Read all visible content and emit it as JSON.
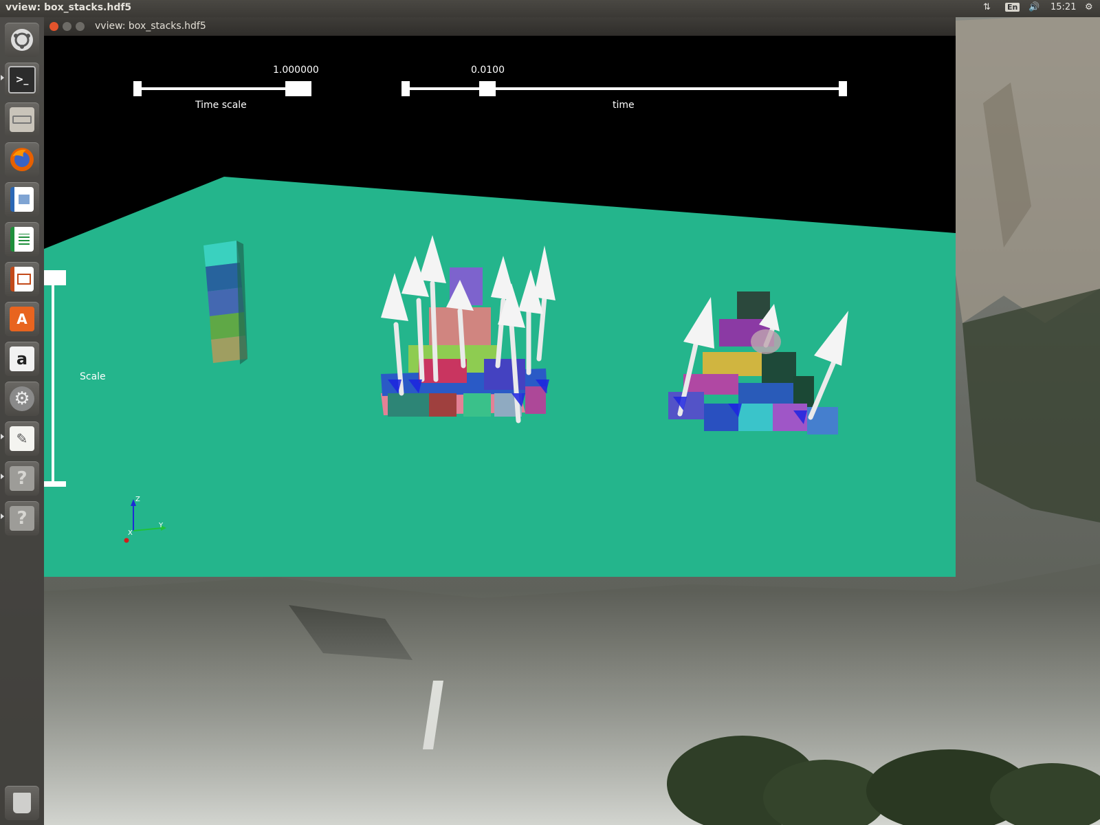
{
  "top_panel": {
    "title": "vview: box_stacks.hdf5",
    "keyboard": "En",
    "time": "15:21"
  },
  "window": {
    "title": "vview: box_stacks.hdf5"
  },
  "hud": {
    "time_scale": {
      "label": "Time scale",
      "value": "1.000000",
      "level": 1.0
    },
    "time": {
      "label": "time",
      "value": "0.0100",
      "level": 0.18
    },
    "scale": {
      "label": "Scale",
      "level": 1.0
    }
  },
  "axes": {
    "z": "Z",
    "y": "Y",
    "x": "X"
  },
  "launcher": [
    {
      "name": "ubuntu-dash-icon"
    },
    {
      "name": "terminal-icon"
    },
    {
      "name": "file-manager-icon"
    },
    {
      "name": "firefox-icon"
    },
    {
      "name": "writer-icon"
    },
    {
      "name": "calc-icon"
    },
    {
      "name": "impress-icon"
    },
    {
      "name": "software-center-icon"
    },
    {
      "name": "amazon-icon"
    },
    {
      "name": "system-settings-icon"
    },
    {
      "name": "text-editor-icon"
    },
    {
      "name": "unknown-app-icon"
    },
    {
      "name": "unknown-app-icon"
    },
    {
      "name": "trash-icon"
    }
  ],
  "colors": {
    "ground": "#24b58c",
    "background": "#000000",
    "panel": "#3b3935"
  }
}
